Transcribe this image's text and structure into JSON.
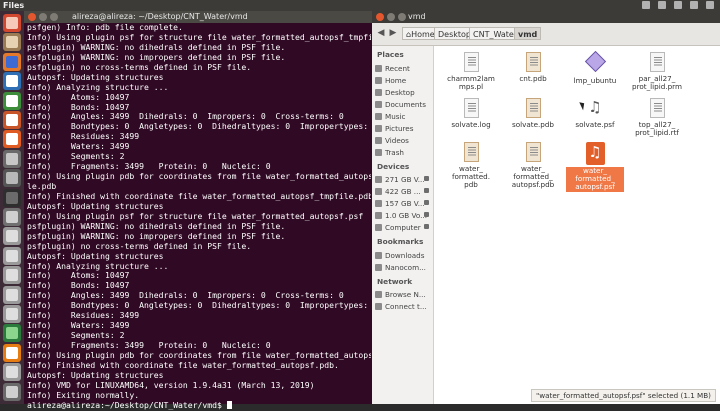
{
  "top_panel": {
    "app_name": "Files"
  },
  "launcher": {
    "items": [
      {
        "icon": "search-icon",
        "color": "#d2472f",
        "inner": "#f6c9b9"
      },
      {
        "icon": "files-icon",
        "color": "#9a7b54",
        "inner": "#e7d3b4"
      },
      {
        "icon": "firefox-icon",
        "color": "#e5792b",
        "inner": "#3d6ad3"
      },
      {
        "icon": "writer-icon",
        "color": "#2f6fb6",
        "inner": "#ffffff"
      },
      {
        "icon": "calc-icon",
        "color": "#3d8d3b",
        "inner": "#ffffff"
      },
      {
        "icon": "impress-icon",
        "color": "#c8542a",
        "inner": "#ffffff"
      },
      {
        "icon": "software-center-icon",
        "color": "#e05b24",
        "inner": "#ffffff"
      },
      {
        "icon": "help-icon",
        "color": "#6a6a6a",
        "inner": "#c7c7c7"
      },
      {
        "icon": "settings-icon",
        "color": "#555555",
        "inner": "#b8b8b8"
      },
      {
        "icon": "terminal-icon",
        "color": "#2e2e2e",
        "inner": "#6b6b6b"
      },
      {
        "icon": "usb-drive-icon",
        "color": "#707070",
        "inner": "#cfcfcf"
      },
      {
        "icon": "drive-icon",
        "color": "#9a9a9a",
        "inner": "#dedede"
      },
      {
        "icon": "drive-icon",
        "color": "#9a9a9a",
        "inner": "#dedede"
      },
      {
        "icon": "drive-icon",
        "color": "#9a9a9a",
        "inner": "#dedede"
      },
      {
        "icon": "drive-icon",
        "color": "#9a9a9a",
        "inner": "#dedede"
      },
      {
        "icon": "drive-icon",
        "color": "#9a9a9a",
        "inner": "#dedede"
      },
      {
        "icon": "vmd-icon",
        "color": "#2b7b3c",
        "inner": "#8bd58e"
      },
      {
        "icon": "vlc-icon",
        "color": "#e57c13",
        "inner": "#ffffff"
      },
      {
        "icon": "drive-icon",
        "color": "#9a9a9a",
        "inner": "#dedede"
      },
      {
        "icon": "trash-icon",
        "color": "#6a6a6a",
        "inner": "#cfcfcf"
      }
    ]
  },
  "terminal": {
    "title": "alireza@alireza: ~/Desktop/CNT_Water/vmd",
    "lines": [
      "psfgen) Info: pdb file complete.",
      "Info) Using plugin psf for structure file water_formatted_autopsf_tmpfile.psf",
      "psfplugin) WARNING: no dihedrals defined in PSF file.",
      "psfplugin) WARNING: no impropers defined in PSF file.",
      "psfplugin) no cross-terms defined in PSF file.",
      "Autopsf: Updating structures",
      "Info) Analyzing structure ...",
      "Info)    Atoms: 10497",
      "Info)    Bonds: 10497",
      "Info)    Angles: 3499  Dihedrals: 0  Impropers: 0  Cross-terms: 0",
      "Info)    Bondtypes: 0  Angletypes: 0  Dihedraltypes: 0  Impropertypes: 0",
      "Info)    Residues: 3499",
      "Info)    Waters: 3499",
      "Info)    Segments: 2",
      "Info)    Fragments: 3499   Protein: 0   Nucleic: 0",
      "Info) Using plugin pdb for coordinates from file water_formatted_autopsf_tmpfi",
      "le.pdb",
      "Info) Finished with coordinate file water_formatted_autopsf_tmpfile.pdb.",
      "Autopsf: Updating structures",
      "Info) Using plugin psf for structure file water_formatted_autopsf.psf",
      "psfplugin) WARNING: no dihedrals defined in PSF file.",
      "psfplugin) WARNING: no impropers defined in PSF file.",
      "psfplugin) no cross-terms defined in PSF file.",
      "Autopsf: Updating structures",
      "Info) Analyzing structure ...",
      "Info)    Atoms: 10497",
      "Info)    Bonds: 10497",
      "Info)    Angles: 3499  Dihedrals: 0  Impropers: 0  Cross-terms: 0",
      "Info)    Bondtypes: 0  Angletypes: 0  Dihedraltypes: 0  Impropertypes: 0",
      "Info)    Residues: 3499",
      "Info)    Waters: 3499",
      "Info)    Segments: 2",
      "Info)    Fragments: 3499   Protein: 0   Nucleic: 0",
      "Info) Using plugin pdb for coordinates from file water_formatted_autopsf.pdb",
      "Info) Finished with coordinate file water_formatted_autopsf.pdb.",
      "Autopsf: Updating structures",
      "Info) VMD for LINUXAMD64, version 1.9.4a31 (March 13, 2019)",
      "Info) Exiting normally.",
      "alireza@alireza:~/Desktop/CNT_Water/vmd$ "
    ]
  },
  "file_manager": {
    "title": "vmd",
    "breadcrumbs": [
      "Home",
      "Desktop",
      "CNT_Water",
      "vmd"
    ],
    "sidebar": {
      "places_header": "Places",
      "places": [
        "Recent",
        "Home",
        "Desktop",
        "Documents",
        "Music",
        "Pictures",
        "Videos",
        "Trash"
      ],
      "devices_header": "Devices",
      "devices": [
        "271 GB V...",
        "422 GB ...",
        "157 GB V...",
        "1.0 GB Vo...",
        "Computer"
      ],
      "bookmarks_header": "Bookmarks",
      "bookmarks": [
        "Downloads",
        "Nanocom..."
      ],
      "network_header": "Network",
      "network": [
        "Browse N...",
        "Connect t..."
      ]
    },
    "files": [
      {
        "name": "charmm2lammps.pl",
        "label": [
          "charmm2lam",
          "mps.pl"
        ],
        "kind": "text"
      },
      {
        "name": "cnt.pdb",
        "label": [
          "cnt.pdb"
        ],
        "kind": "pdb"
      },
      {
        "name": "lmp_ubuntu",
        "label": [
          "lmp_ubuntu"
        ],
        "kind": "exec"
      },
      {
        "name": "par_all27_prot_lipid.prm",
        "label": [
          "par_all27_",
          "prot_lipid.prm"
        ],
        "kind": "text"
      },
      {
        "name": "solvate.log",
        "label": [
          "solvate.log"
        ],
        "kind": "text"
      },
      {
        "name": "solvate.pdb",
        "label": [
          "solvate.pdb"
        ],
        "kind": "pdb"
      },
      {
        "name": "solvate.psf",
        "label": [
          "solvate.psf"
        ],
        "kind": "audio"
      },
      {
        "name": "top_all27_prot_lipid.rtf",
        "label": [
          "top_all27_",
          "prot_lipid.rtf"
        ],
        "kind": "text"
      },
      {
        "name": "water_formatted.pdb",
        "label": [
          "water_",
          "formatted.",
          "pdb"
        ],
        "kind": "pdb"
      },
      {
        "name": "water_formatted_autopsf.pdb",
        "label": [
          "water_",
          "formatted_",
          "autopsf.pdb"
        ],
        "kind": "pdb"
      },
      {
        "name": "water_formatted_autopsf.psf",
        "label": [
          "water_",
          "formatted_",
          "autopsf.psf"
        ],
        "kind": "audio",
        "selected": true
      }
    ],
    "status": "\"water_formatted_autopsf.psf\" selected (1.1 MB)"
  }
}
